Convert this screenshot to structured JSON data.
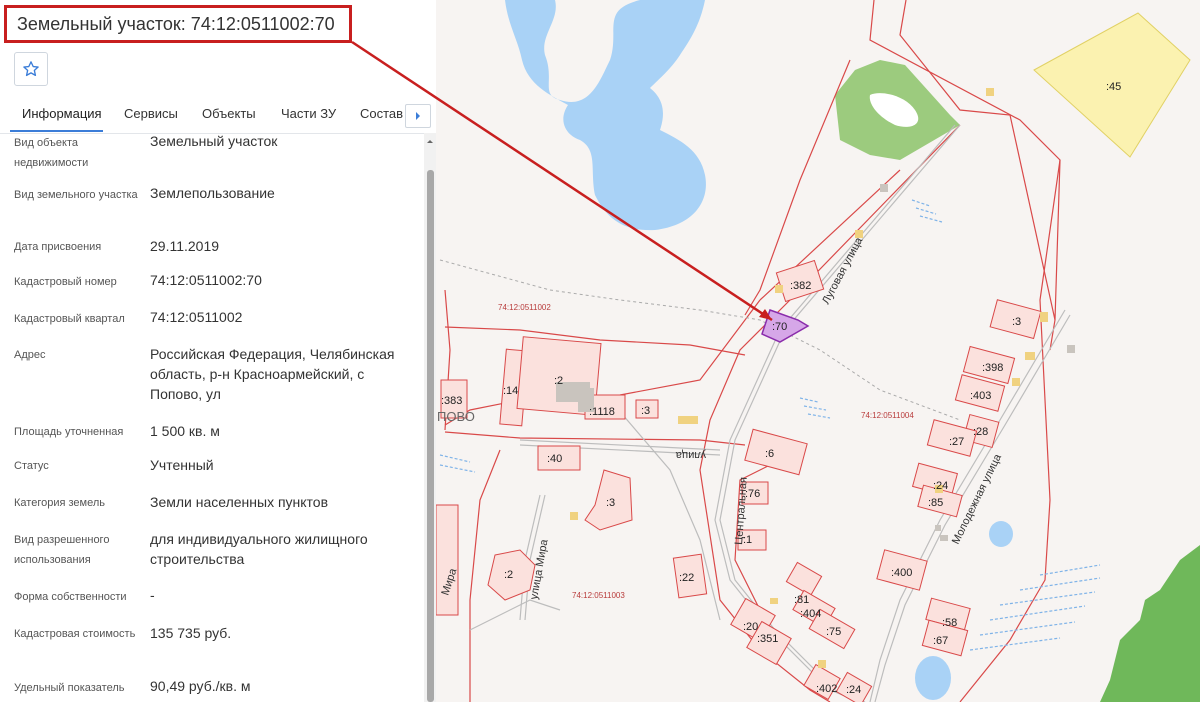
{
  "header": {
    "title": "Земельный участок: 74:12:0511002:70",
    "favorite_icon": "star-outline-icon"
  },
  "tabs": [
    {
      "label": "Информация",
      "active": true
    },
    {
      "label": "Сервисы",
      "active": false
    },
    {
      "label": "Объекты",
      "active": false
    },
    {
      "label": "Части ЗУ",
      "active": false
    },
    {
      "label": "Состав",
      "active": false
    }
  ],
  "tabs_scroll_icon": "chevron-right-icon",
  "accent_color": "#3b7dd8",
  "highlight_color": "#c81f1f",
  "info": [
    {
      "label": "Вид объекта недвижимости",
      "value": "Земельный участок"
    },
    {
      "label": "Вид земельного участка",
      "value": "Землепользование"
    },
    {
      "label": "Дата присвоения",
      "value": "29.11.2019"
    },
    {
      "label": "Кадастровый номер",
      "value": "74:12:0511002:70"
    },
    {
      "label": "Кадастровый квартал",
      "value": "74:12:0511002"
    },
    {
      "label": "Адрес",
      "value": "Российская Федерация, Челябинская область, р-н Красноармейский, с Попово, ул"
    },
    {
      "label": "Площадь уточненная",
      "value": "1 500 кв. м"
    },
    {
      "label": "Статус",
      "value": "Учтенный"
    },
    {
      "label": "Категория земель",
      "value": "Земли населенных пунктов"
    },
    {
      "label": "Вид разрешенного использования",
      "value": "для индивидуального жилищного строительства"
    },
    {
      "label": "Форма собственности",
      "value": "-"
    },
    {
      "label": "Кадастровая стоимость",
      "value": "135 735 руб."
    },
    {
      "label": "Удельный показатель",
      "value": "90,49 руб./кв. м"
    }
  ],
  "map": {
    "quarters": [
      "74:12:0511002",
      "74:12:0511004",
      "74:12:0511003"
    ],
    "selected_parcel": ":70",
    "parcels": [
      ":45",
      ":382",
      ":3",
      ":398",
      ":403",
      ":28",
      ":27",
      ":24",
      ":85",
      ":400",
      ":58",
      ":67",
      ":383",
      ":14",
      ":2",
      ":1118",
      ":3",
      ":40",
      ":6",
      ":76",
      ":1",
      ":3",
      ":2",
      ":22",
      ":81",
      ":404",
      ":75",
      ":20",
      ":351",
      ":402",
      ":24"
    ],
    "streets": [
      "Луговая улица",
      "Молодежная улица",
      "Центральная",
      "улица Мира",
      "Мира",
      "улица"
    ],
    "village_fragment": "ПОВО"
  }
}
